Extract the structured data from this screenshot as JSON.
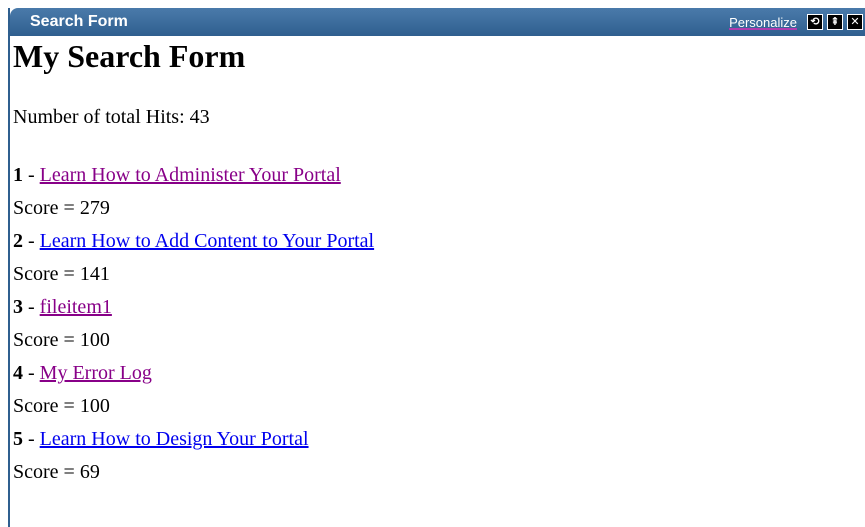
{
  "portlet": {
    "title": "Search Form",
    "personalize_label": "Personalize",
    "controls": [
      {
        "name": "refresh-icon",
        "glyph": "⟲"
      },
      {
        "name": "minimize-icon",
        "glyph": "⇞"
      },
      {
        "name": "close-icon",
        "glyph": "✕"
      }
    ]
  },
  "main": {
    "heading": "My Search Form",
    "hits_label": "Number of total Hits:",
    "hits_count": "43",
    "results": [
      {
        "num": "1",
        "sep": " - ",
        "title": "Learn How to Administer Your Portal",
        "visited": true,
        "score_label": "Score = 279"
      },
      {
        "num": "2",
        "sep": " - ",
        "title": "Learn How to Add Content to Your Portal",
        "visited": false,
        "score_label": "Score = 141"
      },
      {
        "num": "3",
        "sep": " - ",
        "title": "fileitem1",
        "visited": true,
        "score_label": "Score = 100"
      },
      {
        "num": "4",
        "sep": " - ",
        "title": "My Error Log",
        "visited": true,
        "score_label": "Score = 100"
      },
      {
        "num": "5",
        "sep": " - ",
        "title": "Learn How to Design Your Portal",
        "visited": false,
        "score_label": "Score = 69"
      }
    ]
  },
  "colors": {
    "titlebar": "#2f5f8f",
    "visited_link": "#880088",
    "link": "#0000ee"
  }
}
